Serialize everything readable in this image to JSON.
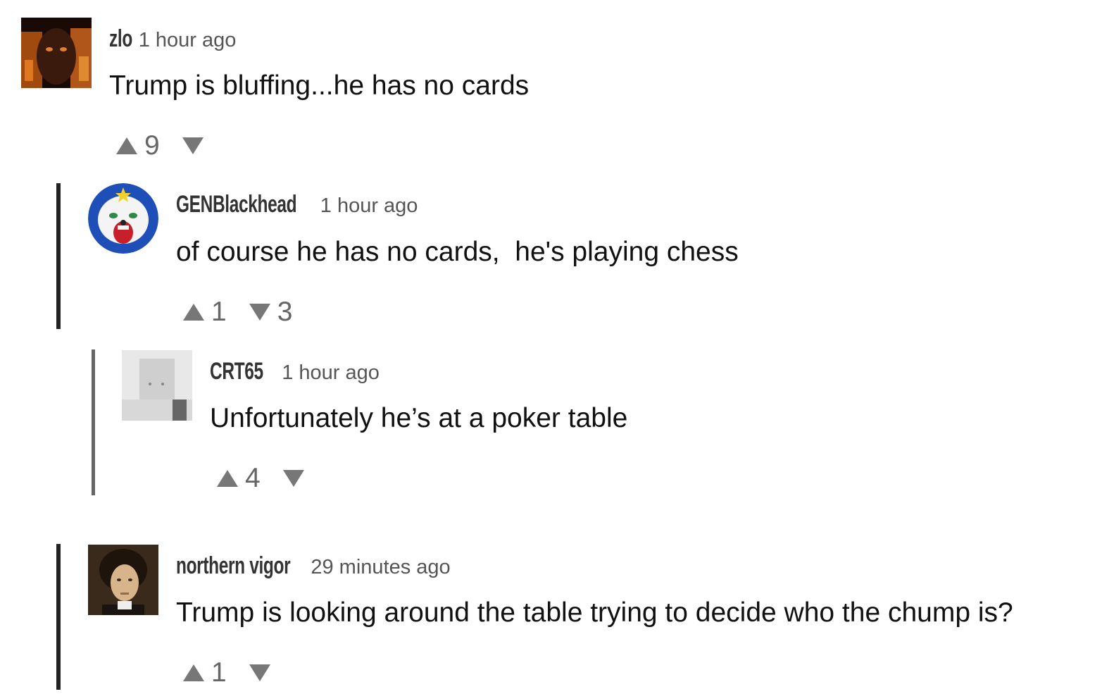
{
  "comments": [
    {
      "username": "zlo",
      "timestamp": "1 hour ago",
      "text": "Trump is bluffing...he has no cards",
      "upvotes": "9",
      "downvotes": ""
    },
    {
      "username": "GENBlackhead",
      "timestamp": "1 hour ago",
      "text": "of course he has no cards,  he's playing chess",
      "upvotes": "1",
      "downvotes": "3"
    },
    {
      "username": "CRT65",
      "timestamp": "1 hour ago",
      "text": "Unfortunately he’s at a poker table",
      "upvotes": "4",
      "downvotes": ""
    },
    {
      "username": "northern vigor",
      "timestamp": "29 minutes ago",
      "text": "Trump is looking around the table trying to decide who the chump is?",
      "upvotes": "1",
      "downvotes": ""
    }
  ],
  "colors": {
    "thread_bar": "#222222",
    "thread_bar_nested": "#666666",
    "vote_arrow": "#777777"
  },
  "icons": {
    "upvote": "triangle-up-icon",
    "downvote": "triangle-down-icon"
  }
}
